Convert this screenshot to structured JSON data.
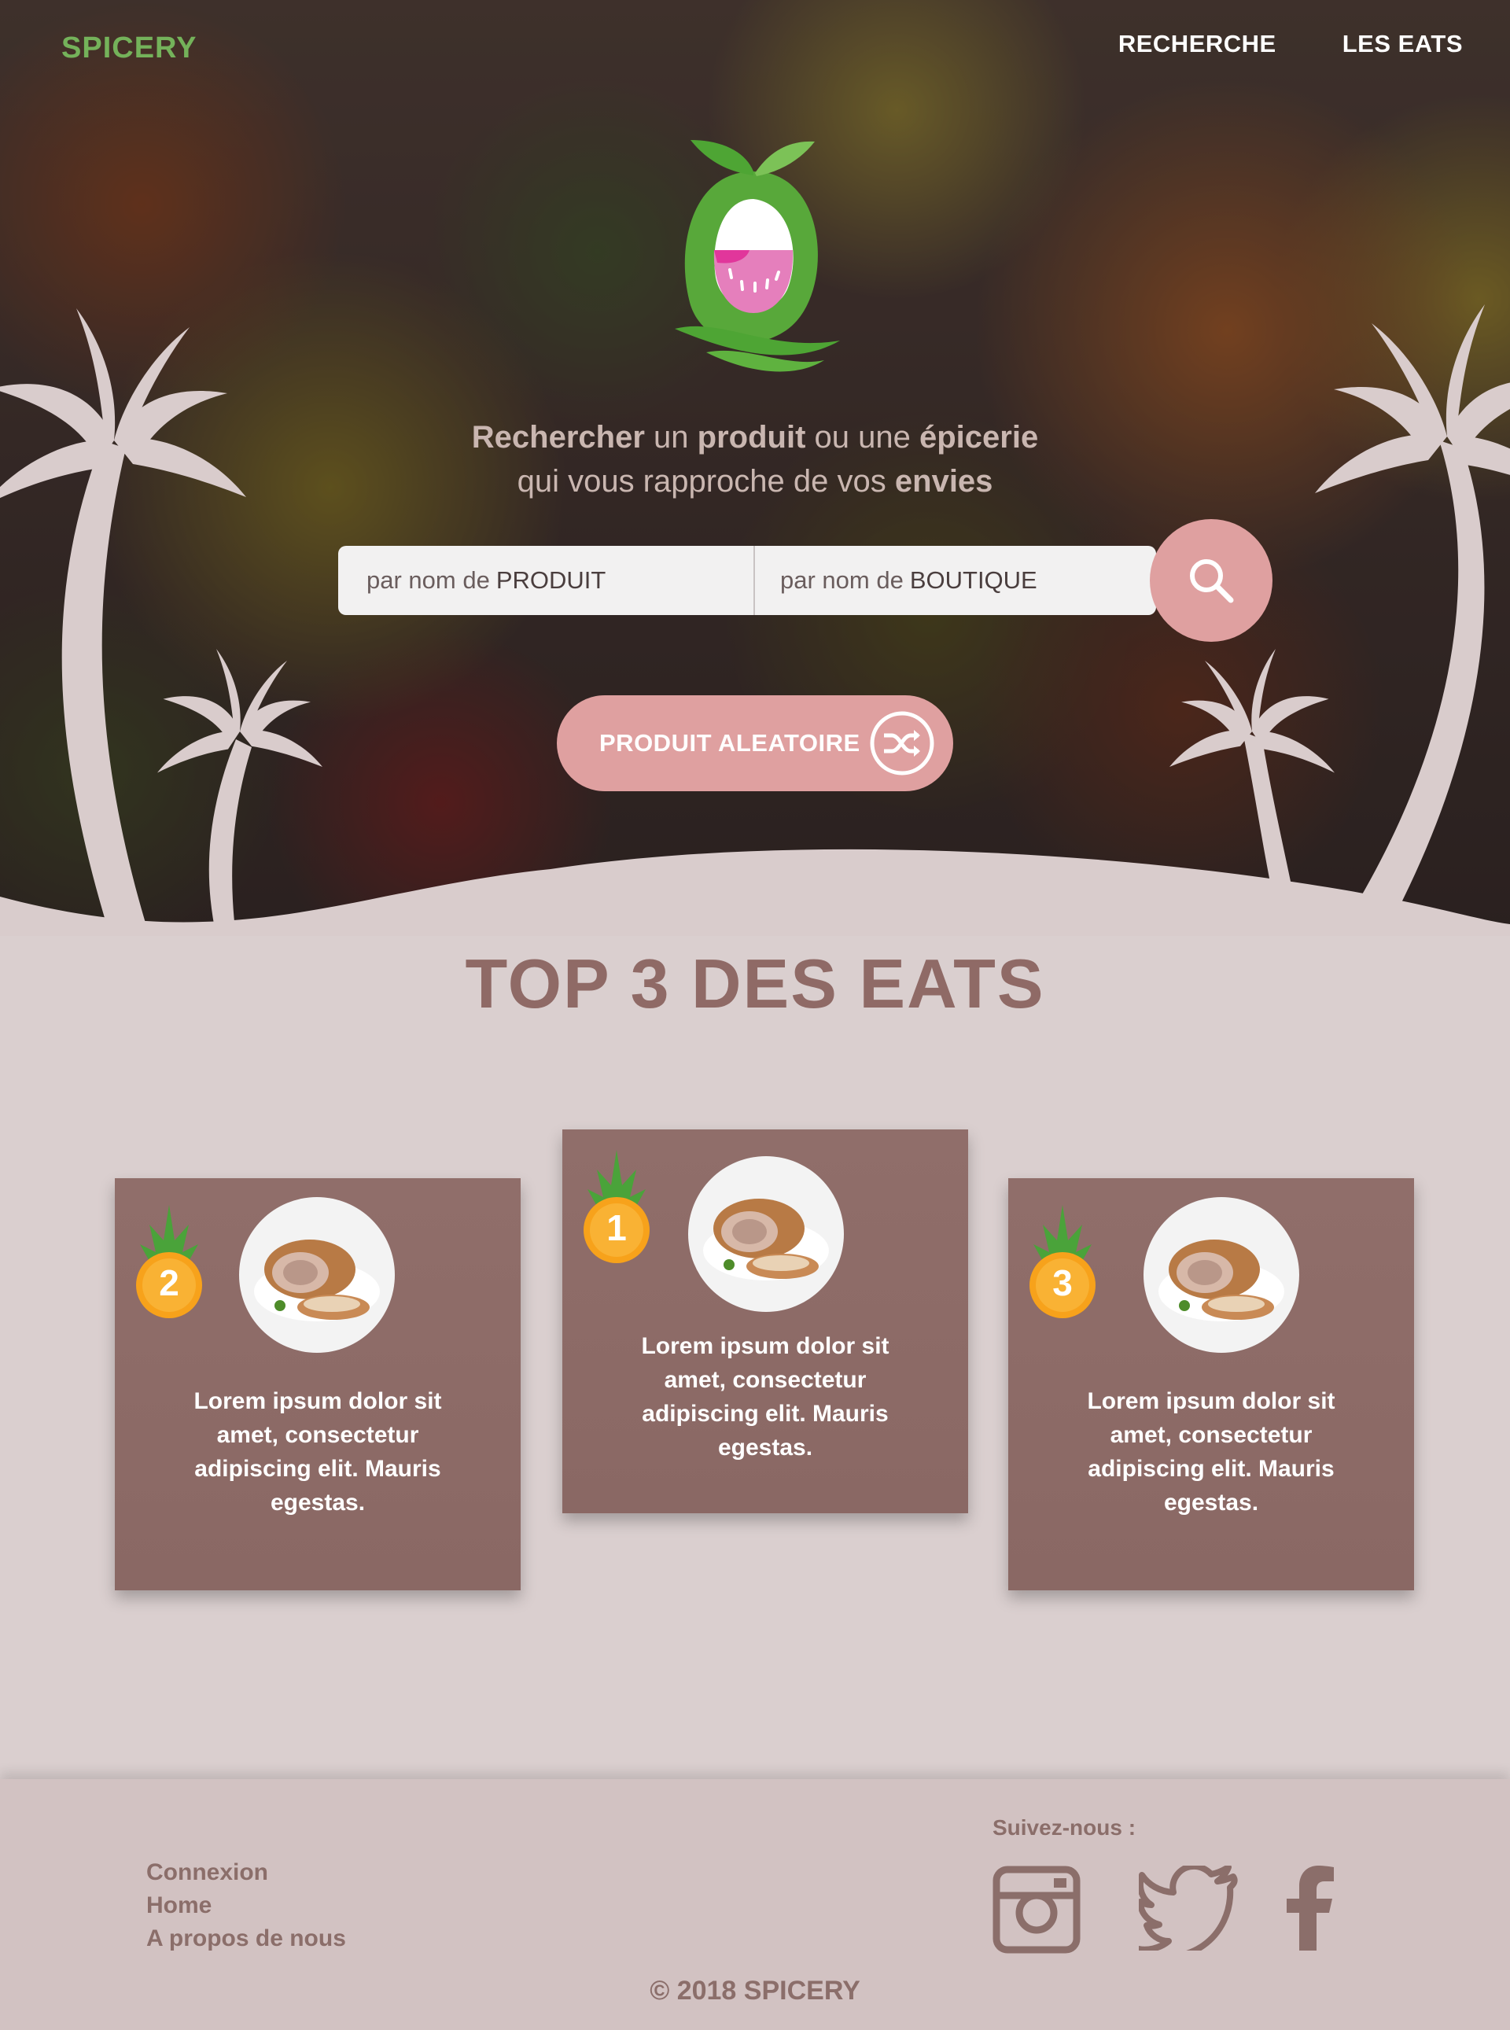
{
  "brand": "SPICERY",
  "nav": {
    "search": "RECHERCHE",
    "eats": "LES EATS"
  },
  "hero": {
    "tagline": {
      "w1": "Rechercher",
      "w2": "un",
      "w3": "produit",
      "w4": "ou une",
      "w5": "épicerie",
      "w6": "qui vous rapproche de vos",
      "w7": "envies"
    },
    "search": {
      "product_prefix": "par nom de",
      "product_keyword": "PRODUIT",
      "shop_prefix": "par nom de",
      "shop_keyword": "BOUTIQUE"
    },
    "random_button": "PRODUIT ALEATOIRE"
  },
  "top3": {
    "title": "TOP 3 DES EATS",
    "cards": [
      {
        "rank": "2",
        "text": "Lorem ipsum dolor sit amet, consectetur adipiscing elit. Mauris egestas."
      },
      {
        "rank": "1",
        "text": "Lorem ipsum dolor sit amet, consectetur adipiscing elit. Mauris egestas."
      },
      {
        "rank": "3",
        "text": "Lorem ipsum dolor sit amet, consectetur adipiscing elit. Mauris egestas."
      }
    ]
  },
  "footer": {
    "links": [
      "Connexion",
      "Home",
      "A propos de nous"
    ],
    "follow": "Suivez-nous :",
    "social": [
      "instagram-icon",
      "twitter-icon",
      "facebook-icon"
    ],
    "copyright": "© 2018 SPICERY"
  },
  "colors": {
    "brand_green": "#74b25a",
    "accent_pink": "#dfa0a0",
    "card_brown": "#8d6b67",
    "page_bg": "#dacfcf",
    "footer_bg": "#d2c2c2",
    "title_brown": "#8f6a66"
  }
}
